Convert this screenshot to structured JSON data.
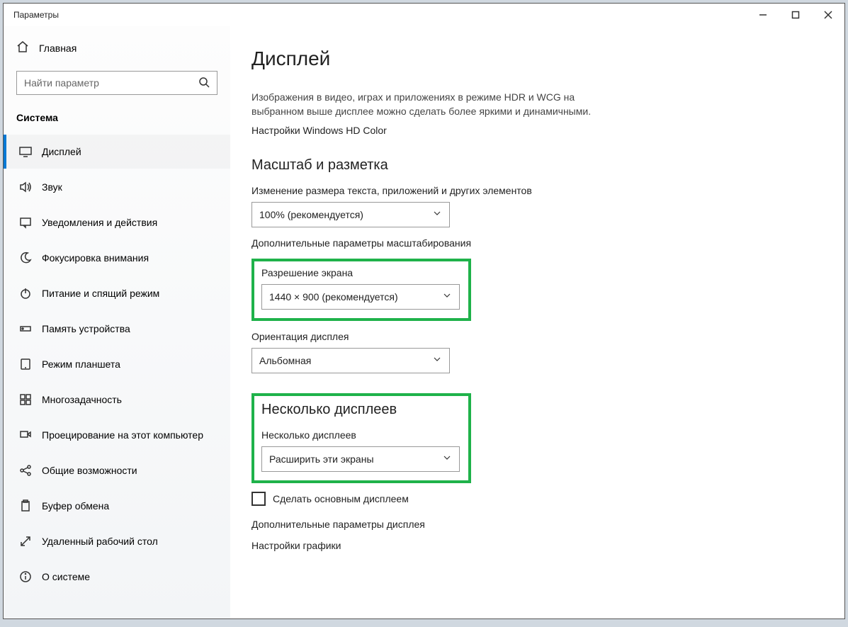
{
  "window": {
    "title": "Параметры"
  },
  "sidebar": {
    "home": "Главная",
    "search_placeholder": "Найти параметр",
    "category": "Система",
    "items": [
      {
        "label": "Дисплей"
      },
      {
        "label": "Звук"
      },
      {
        "label": "Уведомления и действия"
      },
      {
        "label": "Фокусировка внимания"
      },
      {
        "label": "Питание и спящий режим"
      },
      {
        "label": "Память устройства"
      },
      {
        "label": "Режим планшета"
      },
      {
        "label": "Многозадачность"
      },
      {
        "label": "Проецирование на этот компьютер"
      },
      {
        "label": "Общие возможности"
      },
      {
        "label": "Буфер обмена"
      },
      {
        "label": "Удаленный рабочий стол"
      },
      {
        "label": "О системе"
      }
    ]
  },
  "main": {
    "title": "Дисплей",
    "hdr_desc": "Изображения в видео, играх и приложениях в режиме HDR и WCG на выбранном выше дисплее можно сделать более яркими и динамичными.",
    "hdr_link": "Настройки Windows HD Color",
    "scale_heading": "Масштаб и разметка",
    "scale_label": "Изменение размера текста, приложений и других элементов",
    "scale_value": "100% (рекомендуется)",
    "scale_link": "Дополнительные параметры масштабирования",
    "res_label": "Разрешение экрана",
    "res_value": "1440 × 900 (рекомендуется)",
    "orient_label": "Ориентация дисплея",
    "orient_value": "Альбомная",
    "multi_heading": "Несколько дисплеев",
    "multi_label": "Несколько дисплеев",
    "multi_value": "Расширить эти экраны",
    "make_main": "Сделать основным дисплеем",
    "adv_link": "Дополнительные параметры дисплея",
    "gfx_link": "Настройки графики"
  }
}
